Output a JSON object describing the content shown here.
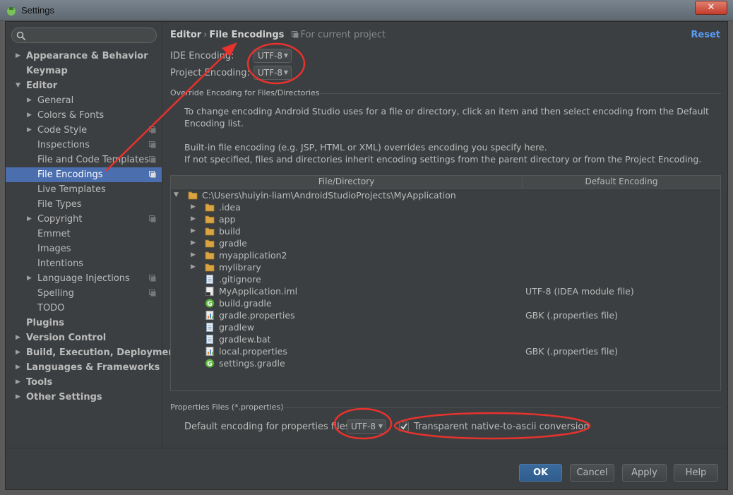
{
  "window": {
    "title": "Settings",
    "close_label": "✕"
  },
  "sidebar": {
    "search_placeholder": "",
    "items": [
      {
        "label": "Appearance & Behavior",
        "bold": true,
        "arrow": "▶",
        "indent": 0
      },
      {
        "label": "Keymap",
        "bold": true,
        "arrow": "",
        "indent": 0
      },
      {
        "label": "Editor",
        "bold": true,
        "arrow": "▼",
        "indent": 0
      },
      {
        "label": "General",
        "arrow": "▶",
        "indent": 1
      },
      {
        "label": "Colors & Fonts",
        "arrow": "▶",
        "indent": 1
      },
      {
        "label": "Code Style",
        "arrow": "▶",
        "indent": 1,
        "project": true
      },
      {
        "label": "Inspections",
        "arrow": "",
        "indent": 1,
        "project": true
      },
      {
        "label": "File and Code Templates",
        "arrow": "",
        "indent": 1,
        "project": true
      },
      {
        "label": "File Encodings",
        "arrow": "",
        "indent": 1,
        "project": true,
        "selected": true
      },
      {
        "label": "Live Templates",
        "arrow": "",
        "indent": 1
      },
      {
        "label": "File Types",
        "arrow": "",
        "indent": 1
      },
      {
        "label": "Copyright",
        "arrow": "▶",
        "indent": 1,
        "project": true
      },
      {
        "label": "Emmet",
        "arrow": "",
        "indent": 1
      },
      {
        "label": "Images",
        "arrow": "",
        "indent": 1
      },
      {
        "label": "Intentions",
        "arrow": "",
        "indent": 1
      },
      {
        "label": "Language Injections",
        "arrow": "▶",
        "indent": 1,
        "project": true
      },
      {
        "label": "Spelling",
        "arrow": "",
        "indent": 1,
        "project": true
      },
      {
        "label": "TODO",
        "arrow": "",
        "indent": 1
      },
      {
        "label": "Plugins",
        "bold": true,
        "arrow": "",
        "indent": 0
      },
      {
        "label": "Version Control",
        "bold": true,
        "arrow": "▶",
        "indent": 0
      },
      {
        "label": "Build, Execution, Deployment",
        "bold": true,
        "arrow": "▶",
        "indent": 0
      },
      {
        "label": "Languages & Frameworks",
        "bold": true,
        "arrow": "▶",
        "indent": 0
      },
      {
        "label": "Tools",
        "bold": true,
        "arrow": "▶",
        "indent": 0
      },
      {
        "label": "Other Settings",
        "bold": true,
        "arrow": "▶",
        "indent": 0
      }
    ]
  },
  "header": {
    "crumb_parent": "Editor",
    "crumb_sep": "›",
    "crumb_current": "File Encodings",
    "scope": "For current project",
    "reset_label": "Reset"
  },
  "encodings": {
    "ide_label": "IDE Encoding:",
    "ide_value": "UTF-8",
    "project_label": "Project Encoding:",
    "project_value": "UTF-8"
  },
  "override": {
    "title": "Override Encoding for Files/Directories",
    "desc1": "To change encoding Android Studio uses for a file or directory, click an item and then select encoding from the Default Encoding list.",
    "desc2": "Built-in file encoding (e.g. JSP, HTML or XML) overrides encoding you specify here.",
    "desc3": "If not specified, files and directories inherit encoding settings from the parent directory or from the Project Encoding."
  },
  "table": {
    "col_file": "File/Directory",
    "col_encoding": "Default Encoding",
    "rows": [
      {
        "name": "C:\\Users\\huiyin-liam\\AndroidStudioProjects\\MyApplication",
        "arrow": "▼",
        "icon": "folder",
        "level": 0,
        "encoding": ""
      },
      {
        "name": ".idea",
        "arrow": "▶",
        "icon": "folder",
        "level": 1,
        "encoding": ""
      },
      {
        "name": "app",
        "arrow": "▶",
        "icon": "folder",
        "level": 1,
        "encoding": ""
      },
      {
        "name": "build",
        "arrow": "▶",
        "icon": "folder",
        "level": 1,
        "encoding": ""
      },
      {
        "name": "gradle",
        "arrow": "▶",
        "icon": "folder",
        "level": 1,
        "encoding": ""
      },
      {
        "name": "myapplication2",
        "arrow": "▶",
        "icon": "folder",
        "level": 1,
        "encoding": ""
      },
      {
        "name": "mylibrary",
        "arrow": "▶",
        "icon": "folder",
        "level": 1,
        "encoding": ""
      },
      {
        "name": ".gitignore",
        "arrow": "",
        "icon": "text",
        "level": 1,
        "encoding": ""
      },
      {
        "name": "MyApplication.iml",
        "arrow": "",
        "icon": "iml",
        "level": 1,
        "encoding": "UTF-8 (IDEA module file)"
      },
      {
        "name": "build.gradle",
        "arrow": "",
        "icon": "gradle",
        "level": 1,
        "encoding": ""
      },
      {
        "name": "gradle.properties",
        "arrow": "",
        "icon": "properties",
        "level": 1,
        "encoding": "GBK (.properties file)"
      },
      {
        "name": "gradlew",
        "arrow": "",
        "icon": "text",
        "level": 1,
        "encoding": ""
      },
      {
        "name": "gradlew.bat",
        "arrow": "",
        "icon": "text",
        "level": 1,
        "encoding": ""
      },
      {
        "name": "local.properties",
        "arrow": "",
        "icon": "properties",
        "level": 1,
        "encoding": "GBK (.properties file)"
      },
      {
        "name": "settings.gradle",
        "arrow": "",
        "icon": "gradle",
        "level": 1,
        "encoding": ""
      }
    ]
  },
  "properties": {
    "title": "Properties Files (*.properties)",
    "default_label": "Default encoding for properties files:",
    "default_value": "UTF-8",
    "native_label": "Transparent native-to-ascii conversion",
    "native_checked": true
  },
  "buttons": {
    "ok": "OK",
    "cancel": "Cancel",
    "apply": "Apply",
    "help": "Help"
  },
  "colors": {
    "accent": "#4b6eaf",
    "link": "#589df6",
    "annotation": "#e8322d"
  }
}
